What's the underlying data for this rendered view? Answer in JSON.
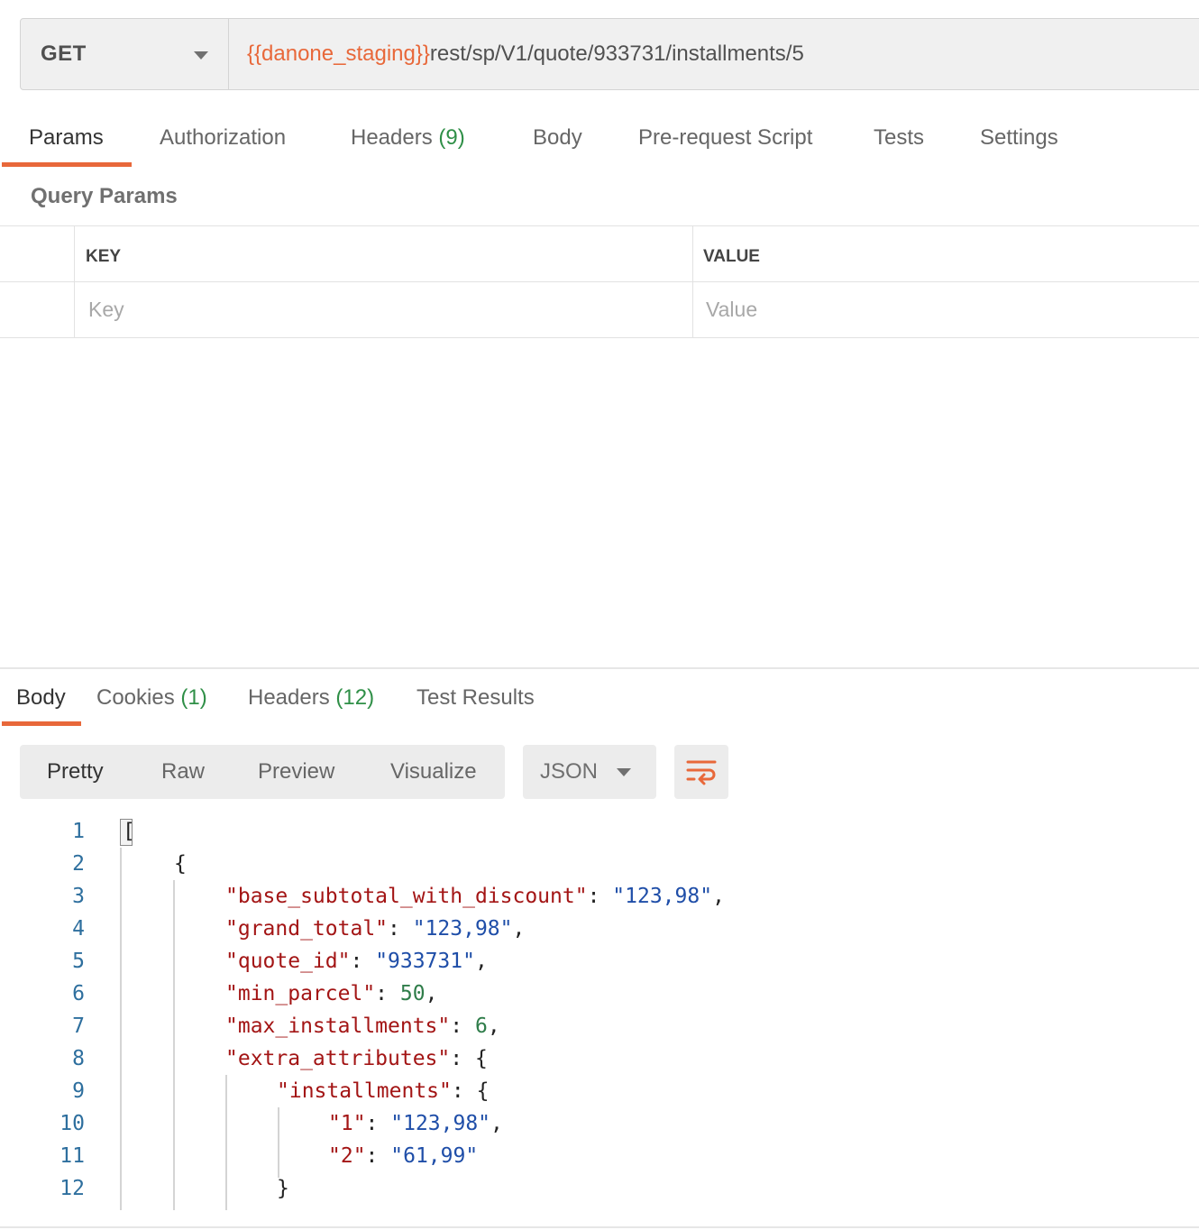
{
  "request": {
    "method": "GET",
    "url_variable": "{{danone_staging}}",
    "url_path": "rest/sp/V1/quote/933731/installments/5"
  },
  "request_tabs": [
    {
      "label": "Params",
      "count": ""
    },
    {
      "label": "Authorization",
      "count": ""
    },
    {
      "label": "Headers",
      "count": "(9)"
    },
    {
      "label": "Body",
      "count": ""
    },
    {
      "label": "Pre-request Script",
      "count": ""
    },
    {
      "label": "Tests",
      "count": ""
    },
    {
      "label": "Settings",
      "count": ""
    }
  ],
  "active_request_tab": "Params",
  "query_params": {
    "title": "Query Params",
    "key_header": "KEY",
    "value_header": "VALUE",
    "key_placeholder": "Key",
    "value_placeholder": "Value"
  },
  "response_tabs": [
    {
      "label": "Body",
      "count": ""
    },
    {
      "label": "Cookies",
      "count": "(1)"
    },
    {
      "label": "Headers",
      "count": "(12)"
    },
    {
      "label": "Test Results",
      "count": ""
    }
  ],
  "active_response_tab": "Body",
  "view_modes": [
    "Pretty",
    "Raw",
    "Preview",
    "Visualize"
  ],
  "active_view_mode": "Pretty",
  "format": "JSON",
  "icons": {
    "method_caret": "chevron-down-icon",
    "format_caret": "chevron-down-icon",
    "wrap": "word-wrap-icon"
  },
  "colors": {
    "accent": "#e8683a",
    "count_green": "#2f8f47",
    "json_key": "#a31515",
    "json_string": "#1f4ea8",
    "json_number": "#2f7d4a",
    "line_number": "#2e6f9e"
  },
  "code_lines": [
    {
      "n": "1",
      "indent": 0,
      "tokens": [
        {
          "t": "p",
          "v": "["
        }
      ]
    },
    {
      "n": "2",
      "indent": 1,
      "tokens": [
        {
          "t": "p",
          "v": "{"
        }
      ]
    },
    {
      "n": "3",
      "indent": 2,
      "tokens": [
        {
          "t": "k",
          "v": "\"base_subtotal_with_discount\""
        },
        {
          "t": "p",
          "v": ": "
        },
        {
          "t": "s",
          "v": "\"123,98\""
        },
        {
          "t": "p",
          "v": ","
        }
      ]
    },
    {
      "n": "4",
      "indent": 2,
      "tokens": [
        {
          "t": "k",
          "v": "\"grand_total\""
        },
        {
          "t": "p",
          "v": ": "
        },
        {
          "t": "s",
          "v": "\"123,98\""
        },
        {
          "t": "p",
          "v": ","
        }
      ]
    },
    {
      "n": "5",
      "indent": 2,
      "tokens": [
        {
          "t": "k",
          "v": "\"quote_id\""
        },
        {
          "t": "p",
          "v": ": "
        },
        {
          "t": "s",
          "v": "\"933731\""
        },
        {
          "t": "p",
          "v": ","
        }
      ]
    },
    {
      "n": "6",
      "indent": 2,
      "tokens": [
        {
          "t": "k",
          "v": "\"min_parcel\""
        },
        {
          "t": "p",
          "v": ": "
        },
        {
          "t": "n",
          "v": "50"
        },
        {
          "t": "p",
          "v": ","
        }
      ]
    },
    {
      "n": "7",
      "indent": 2,
      "tokens": [
        {
          "t": "k",
          "v": "\"max_installments\""
        },
        {
          "t": "p",
          "v": ": "
        },
        {
          "t": "n",
          "v": "6"
        },
        {
          "t": "p",
          "v": ","
        }
      ]
    },
    {
      "n": "8",
      "indent": 2,
      "tokens": [
        {
          "t": "k",
          "v": "\"extra_attributes\""
        },
        {
          "t": "p",
          "v": ": {"
        }
      ]
    },
    {
      "n": "9",
      "indent": 3,
      "tokens": [
        {
          "t": "k",
          "v": "\"installments\""
        },
        {
          "t": "p",
          "v": ": {"
        }
      ]
    },
    {
      "n": "10",
      "indent": 4,
      "tokens": [
        {
          "t": "k",
          "v": "\"1\""
        },
        {
          "t": "p",
          "v": ": "
        },
        {
          "t": "s",
          "v": "\"123,98\""
        },
        {
          "t": "p",
          "v": ","
        }
      ]
    },
    {
      "n": "11",
      "indent": 4,
      "tokens": [
        {
          "t": "k",
          "v": "\"2\""
        },
        {
          "t": "p",
          "v": ": "
        },
        {
          "t": "s",
          "v": "\"61,99\""
        }
      ]
    },
    {
      "n": "12",
      "indent": 3,
      "tokens": [
        {
          "t": "p",
          "v": "}"
        }
      ]
    }
  ]
}
